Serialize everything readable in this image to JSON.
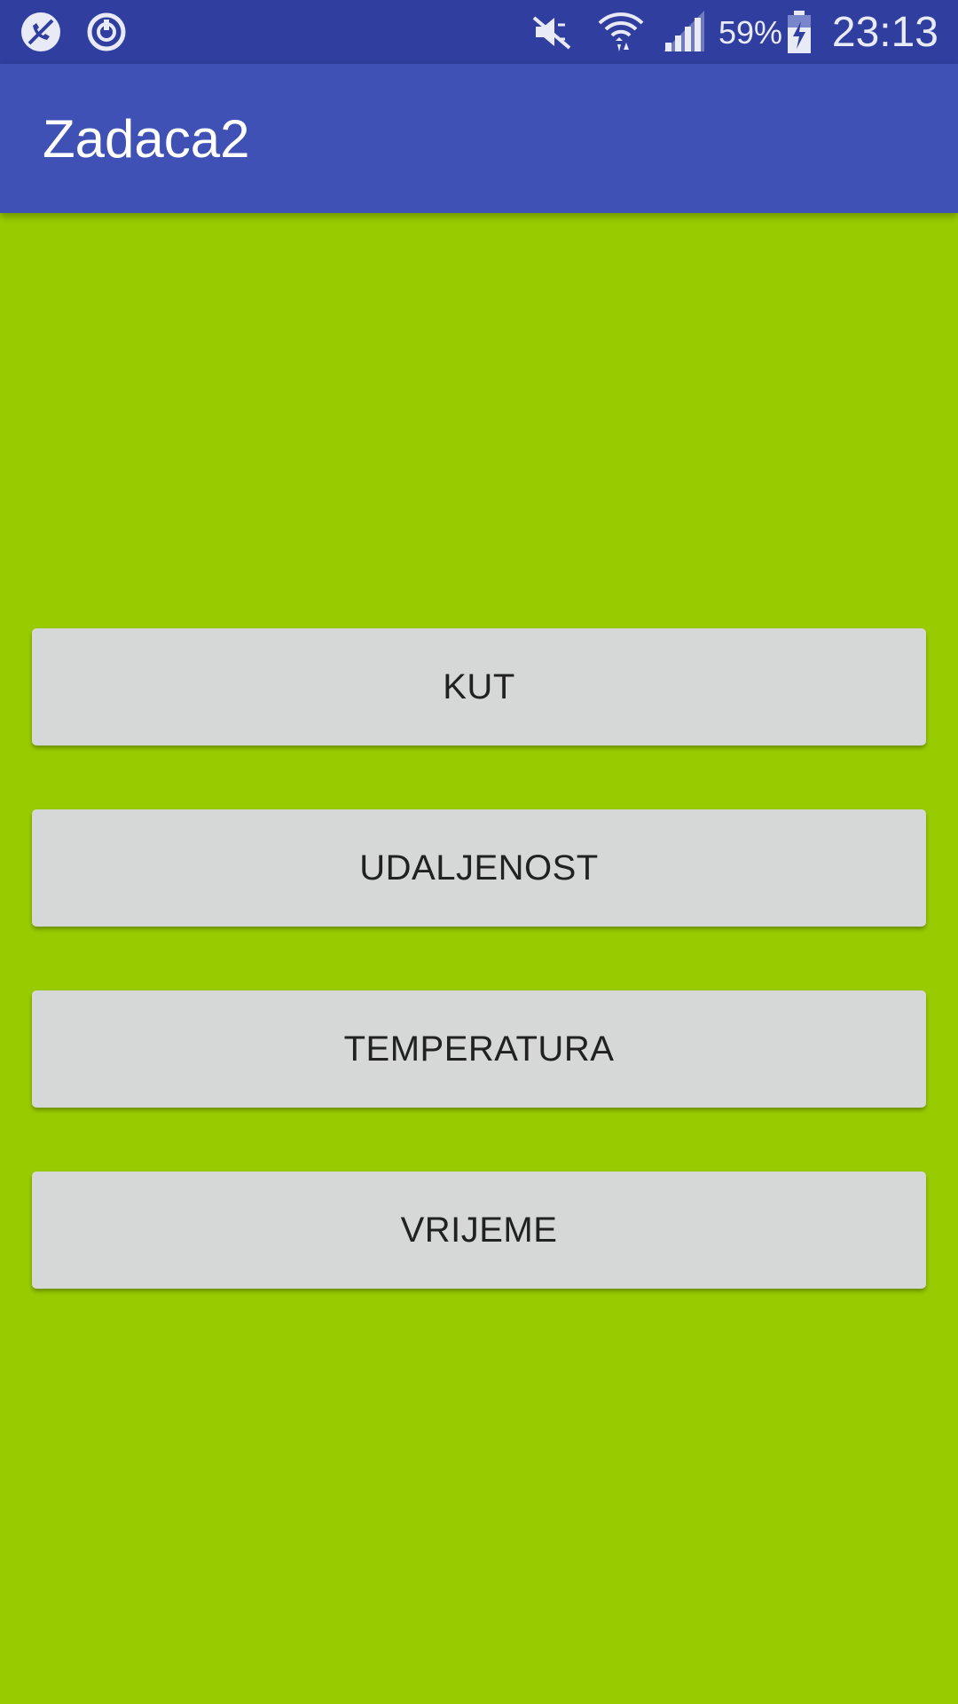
{
  "status_bar": {
    "battery_percent": "59%",
    "clock": "23:13",
    "icons": [
      "no-calls-icon",
      "sync-icon",
      "mute-icon",
      "wifi-icon",
      "signal-icon",
      "battery-charging-icon"
    ],
    "background_color": "#303f9f"
  },
  "app_bar": {
    "title": "Zadaca2",
    "background_color": "#3f51b5"
  },
  "main": {
    "background_color": "#99cc00",
    "buttons": [
      {
        "label": "KUT"
      },
      {
        "label": "UDALJENOST"
      },
      {
        "label": "TEMPERATURA"
      },
      {
        "label": "VRIJEME"
      }
    ]
  }
}
